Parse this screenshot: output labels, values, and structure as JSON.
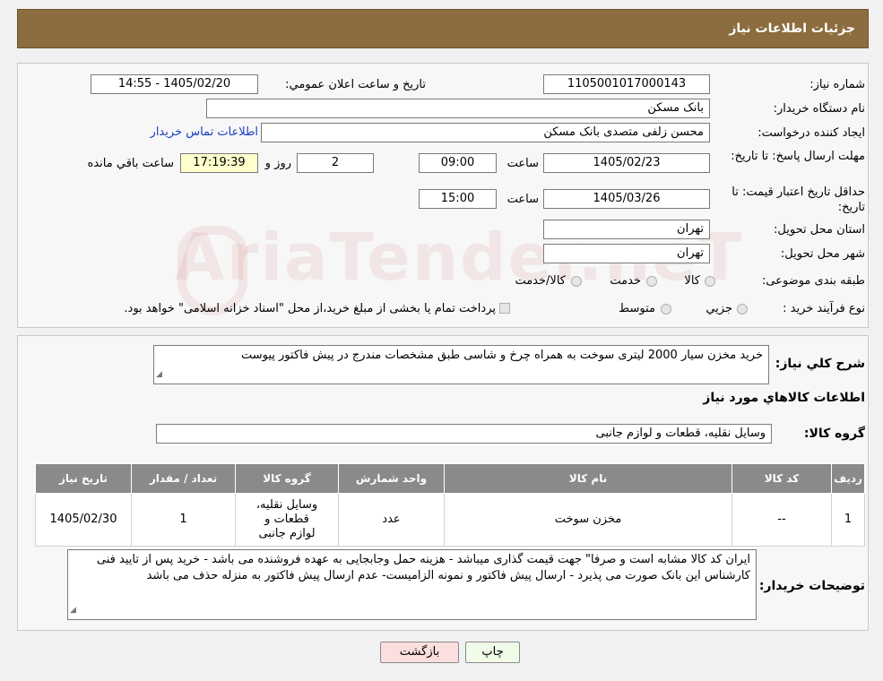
{
  "header": {
    "title": "جزئیات اطلاعات نیاز"
  },
  "watermark": {
    "text": "AriaTender.neT"
  },
  "form": {
    "need_number": {
      "label": "شماره نیاز:",
      "value": "1105001017000143"
    },
    "announce_datetime": {
      "label": "تاریخ و ساعت اعلان عمومي:",
      "value": "1405/02/20 - 14:55"
    },
    "buyer_org": {
      "label": "نام دستگاه خریدار:",
      "value": "بانک مسکن"
    },
    "requester": {
      "label": "ایجاد کننده درخواست:",
      "value": "محسن زلفی متصدی بانک مسکن",
      "contact_link": "اطلاعات تماس خریدار"
    },
    "deadline": {
      "label": "مهلت ارسال پاسخ: تا تاریخ:",
      "date": "1405/02/23",
      "time_label": "ساعت",
      "time": "09:00",
      "days": "2",
      "days_label": "روز و",
      "remaining": "17:19:39",
      "remaining_label": "ساعت باقي مانده"
    },
    "min_validity": {
      "label": "حداقل تاریخ اعتبار قیمت: تا تاریخ:",
      "date": "1405/03/26",
      "time_label": "ساعت",
      "time": "15:00"
    },
    "province": {
      "label": "استان محل تحویل:",
      "value": "تهران"
    },
    "city": {
      "label": "شهر محل تحویل:",
      "value": "تهران"
    },
    "category": {
      "label": "طبقه بندی موضوعی:",
      "options": [
        "کالا",
        "خدمت",
        "کالا/خدمت"
      ]
    },
    "purchase_process": {
      "label": "نوع فرآیند خرید :",
      "options": [
        "جزیي",
        "متوسط"
      ],
      "note": "پرداخت تمام یا بخشی از مبلغ خرید،از محل \"اسناد خزانه اسلامی\" خواهد بود."
    }
  },
  "description": {
    "label": "شرح کلي نياز:",
    "value": "خرید مخزن سیار 2000 لیتری سوخت به همراه چرخ و شاسی طبق مشخصات مندرج در پیش فاکتور پیوست"
  },
  "goods_section": {
    "title": "اطلاعات کالاهاي مورد نياز",
    "group_label": "گروه کالا:",
    "group_value": "وسایل نقلیه، قطعات و لوازم جانبی"
  },
  "table": {
    "headers": [
      "رديف",
      "کد کالا",
      "نام کالا",
      "واحد شمارش",
      "گروه کالا",
      "تعداد / مقدار",
      "تاریخ نیاز"
    ],
    "rows": [
      [
        "1",
        "--",
        "مخزن سوخت",
        "عدد",
        "وسایل نقلیه، قطعات و لوازم جانبی",
        "1",
        "1405/02/30"
      ]
    ]
  },
  "buyer_notes": {
    "label": "توضیحات خریدار:",
    "value": "ایران کد کالا مشابه است و صرفا\" جهت قیمت گذاری میباشد - هزینه حمل وجابجایی به عهده فروشنده می باشد - خرید پس از تایید فنی کارشناس این بانک صورت می پذیرد - ارسال پیش فاکتور و نمونه الزامیست- عدم ارسال پیش فاکتور به منزله حذف می باشد"
  },
  "buttons": {
    "print": "چاپ",
    "back": "بازگشت"
  }
}
